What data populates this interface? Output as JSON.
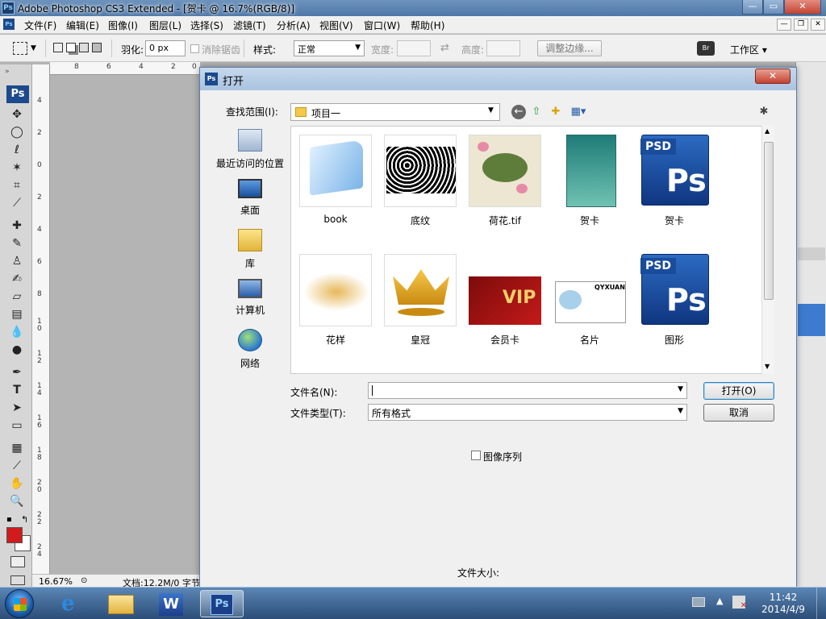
{
  "window": {
    "title": "Adobe Photoshop CS3 Extended - [贺卡 @ 16.7%(RGB/8)]"
  },
  "caption_buttons": [
    "—",
    "▭",
    "✕"
  ],
  "menu": [
    "文件(F)",
    "编辑(E)",
    "图像(I)",
    "图层(L)",
    "选择(S)",
    "滤镜(T)",
    "分析(A)",
    "视图(V)",
    "窗口(W)",
    "帮助(H)"
  ],
  "options": {
    "feather_label": "羽化:",
    "feather_value": "0 px",
    "antialias_label": "消除锯齿",
    "style_label": "样式:",
    "style_value": "正常",
    "width_label": "宽度:",
    "height_label": "高度:",
    "refine_edge": "调整边缘...",
    "workspace": "工作区 ▾"
  },
  "toolbox": {
    "logo": "Ps"
  },
  "rulers": {
    "h_ticks": [
      "8",
      "6",
      "4",
      "2",
      "0"
    ],
    "v_ticks": [
      "4",
      "2",
      "0",
      "2",
      "4",
      "6",
      "8",
      "1 0",
      "1 2",
      "1 4",
      "1 6",
      "1 8",
      "2 0",
      "2 2",
      "2 4"
    ]
  },
  "status": {
    "zoom": "16.67%",
    "doc": "文档:12.2M/0 字节"
  },
  "dialog": {
    "title": "打开",
    "title_icon": "Ps",
    "close": "✕",
    "look_in_label": "查找范围(I):",
    "look_in_value": "项目一",
    "places": [
      {
        "label": "最近访问的位置",
        "icon": "recent-places-icon"
      },
      {
        "label": "桌面",
        "icon": "desktop-icon"
      },
      {
        "label": "库",
        "icon": "libraries-icon"
      },
      {
        "label": "计算机",
        "icon": "computer-icon"
      },
      {
        "label": "网络",
        "icon": "network-icon"
      }
    ],
    "files": [
      {
        "name": "book"
      },
      {
        "name": "底纹"
      },
      {
        "name": "荷花.tif"
      },
      {
        "name": "贺卡"
      },
      {
        "name": "贺卡",
        "thumb_text": "PSD"
      },
      {
        "name": "花样"
      },
      {
        "name": "皇冠"
      },
      {
        "name": "会员卡",
        "thumb_text": "VIP"
      },
      {
        "name": "名片",
        "thumb_text": "QYXUAN"
      },
      {
        "name": "图形",
        "thumb_text": "PSD"
      }
    ],
    "file_name_label": "文件名(N):",
    "file_name_value": "",
    "file_type_label": "文件类型(T):",
    "file_type_value": "所有格式",
    "open_button": "打开(O)",
    "cancel_button": "取消",
    "image_sequence": "图像序列",
    "file_size_label": "文件大小:"
  },
  "taskbar": {
    "time": "11:42",
    "date": "2014/4/9"
  }
}
